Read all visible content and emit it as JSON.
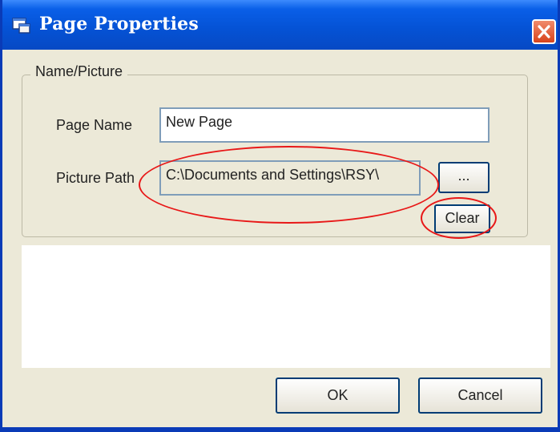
{
  "window": {
    "title": "Page Properties",
    "icon": "page-properties-icon",
    "close_icon": "close-icon"
  },
  "group": {
    "legend": "Name/Picture"
  },
  "page_name": {
    "label": "Page Name",
    "value": "New Page"
  },
  "picture_path": {
    "label": "Picture Path",
    "value": "C:\\Documents and Settings\\RSY\\"
  },
  "browse_button": {
    "label": "..."
  },
  "clear_button": {
    "label": "Clear"
  },
  "footer": {
    "ok_label": "OK",
    "cancel_label": "Cancel"
  },
  "colors": {
    "titlebar": "#0553d6",
    "dialog_bg": "#ece9d8",
    "highlight": "#e81818"
  }
}
